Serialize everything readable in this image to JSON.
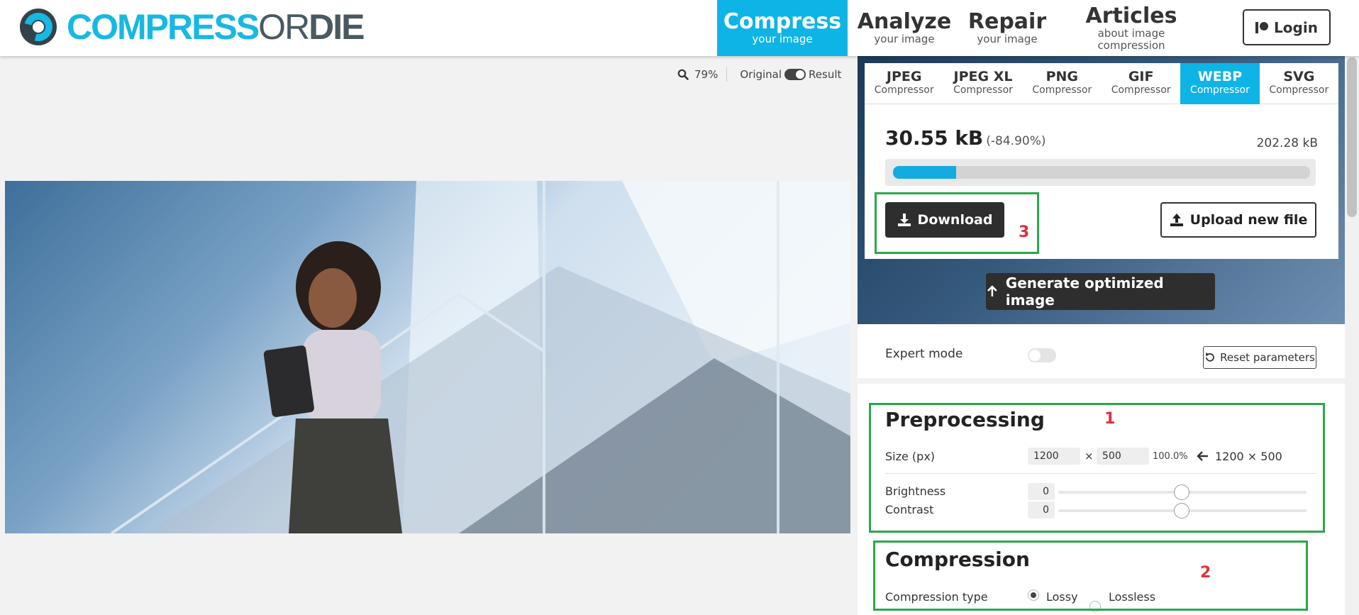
{
  "header": {
    "logo": {
      "part1": "COMPRESS",
      "part2": "OR",
      "part3": "DIE"
    },
    "nav": [
      {
        "title": "Compress",
        "sub": "your image"
      },
      {
        "title": "Analyze",
        "sub": "your image"
      },
      {
        "title": "Repair",
        "sub": "your image"
      },
      {
        "title": "Articles",
        "sub": "about image compression"
      }
    ],
    "active_nav": "Compress",
    "login_label": "Login"
  },
  "viewer": {
    "zoom": "79%",
    "original_label": "Original",
    "result_label": "Result"
  },
  "formats": [
    {
      "title": "JPEG",
      "sub": "Compressor"
    },
    {
      "title": "JPEG XL",
      "sub": "Compressor"
    },
    {
      "title": "PNG",
      "sub": "Compressor"
    },
    {
      "title": "GIF",
      "sub": "Compressor"
    },
    {
      "title": "WEBP",
      "sub": "Compressor"
    },
    {
      "title": "SVG",
      "sub": "Compressor"
    }
  ],
  "active_format": "WEBP",
  "result": {
    "size": "30.55 kB",
    "reduction": "(-84.90%)",
    "original_size": "202.28 kB",
    "progress_fraction": 0.151,
    "download_label": "Download",
    "upload_label": "Upload new file",
    "generate_label": "Generate optimized image"
  },
  "settings": {
    "expert_mode_label": "Expert mode",
    "expert_mode_on": false,
    "reset_label": "Reset parameters"
  },
  "preprocessing": {
    "heading": "Preprocessing",
    "size_label": "Size (px)",
    "width": "1200",
    "height": "500",
    "times": "×",
    "scale": "100.0%",
    "original_dims": "1200 × 500",
    "brightness_label": "Brightness",
    "brightness_value": "0",
    "contrast_label": "Contrast",
    "contrast_value": "0"
  },
  "compression": {
    "heading": "Compression",
    "type_label": "Compression type",
    "options": [
      "Lossy",
      "Lossless"
    ],
    "selected": "Lossy"
  },
  "annotations": {
    "one": "1",
    "two": "2",
    "three": "3"
  },
  "colors": {
    "accent": "#0fb4e6",
    "annotation_box": "#2aa84a",
    "annotation_number": "#e0303a"
  }
}
